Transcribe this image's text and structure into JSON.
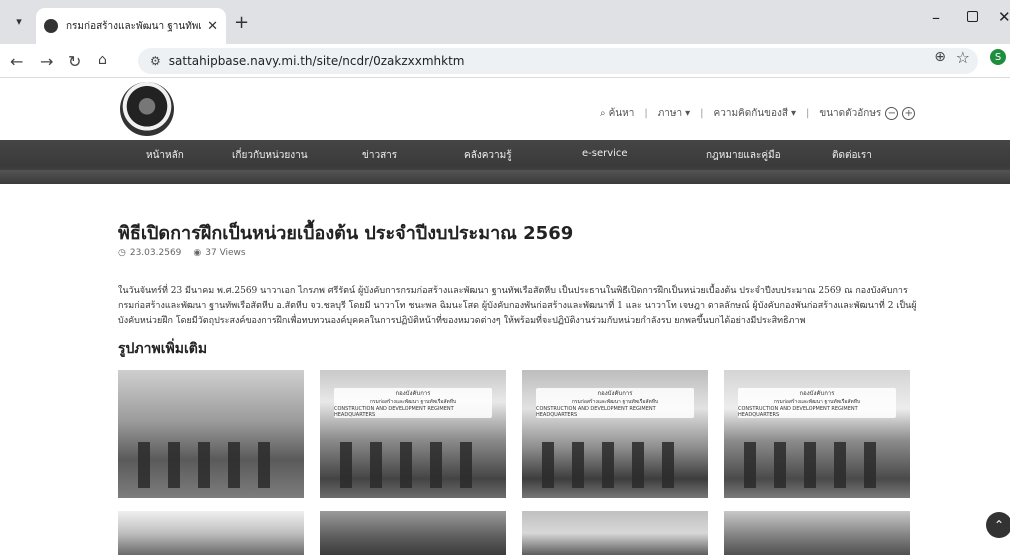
{
  "browser": {
    "tab_title": "กรมก่อสร้างและพัฒนา ฐานทัพเรือสัตหีบ",
    "tab_close": "✕",
    "new_tab": "+",
    "url": "sattahipbase.navy.mi.th/site/ncdr/0zakzxxmhktm",
    "profile_initial": "S"
  },
  "site": {
    "utilities": {
      "search": "ค้นหา",
      "language": "ภาษา",
      "contrast": "ความคิดกันของสี",
      "font_size": "ขนาดตัวอักษร",
      "font_minus": "−",
      "font_plus": "+"
    },
    "nav": [
      {
        "label": "หน้าหลัก"
      },
      {
        "label": "เกี่ยวกับหน่วยงาน"
      },
      {
        "label": "ข่าวสาร"
      },
      {
        "label": "คลังความรู้"
      },
      {
        "label": "e-service"
      },
      {
        "label": "กฎหมายและคู่มือ"
      },
      {
        "label": "ติดต่อเรา"
      }
    ]
  },
  "article": {
    "title": "พิธีเปิดการฝึกเป็นหน่วยเบื้องต้น ประจำปีงบประมาณ 2569",
    "date": "23.03.2569",
    "views": "37 Views",
    "body": "ในวันจันทร์ที่ 23 มีนาคม พ.ศ.2569 นาวาเอก ไกรภพ ศรีรัตน์ ผู้บังคับการกรมก่อสร้างและพัฒนา ฐานทัพเรือสัตหีบ เป็นประธานในพิธีเปิดการฝึกเป็นหน่วยเบื้องต้น ประจำปีงบประมาณ 2569 ณ กองบังคับการ กรมก่อสร้างและพัฒนา ฐานทัพเรือสัตหีบ อ.สัตหีบ จว.ชลบุรี โดยมี นาวาโท ชนะพล ฉิมนะโสด ผู้บังคับกองพันก่อสร้างและพัฒนาที่ 1 และ นาวาโท เจษฎา ดาลลักษณ์ ผู้บังคับกองพันก่อสร้างและพัฒนาที่ 2 เป็นผู้บังคับหน่วยฝึก โดยมีวัตถุประสงค์ของการฝึกเพื่อทบทวนองค์บุคคลในการปฏิบัติหน้าที่ของหมวดต่างๆ ให้พร้อมที่จะปฏิบัติงานร่วมกับหน่วยกำลังรบ ยกพลขึ้นบกได้อย่างมีประสิทธิภาพ",
    "gallery_title": "รูปภาพเพิ่มเติม",
    "sign_line1": "กองบังคับการ",
    "sign_line2": "กรมก่อสร้างและพัฒนา ฐานทัพเรือสัตหีบ",
    "sign_line3": "CONSTRUCTION AND DEVELOPMENT REGIMENT HEADQUARTERS"
  },
  "icons": {
    "tab_menu": "chevron-down-icon",
    "back": "back-arrow-icon",
    "forward": "forward-arrow-icon",
    "reload": "reload-icon",
    "home": "home-icon",
    "site_info": "site-info-icon",
    "zoom": "zoom-icon",
    "bookmark": "star-icon",
    "search": "search-icon",
    "clock": "clock-icon",
    "eye": "eye-icon",
    "scroll_top": "chevron-up-icon"
  },
  "colors": {
    "nav_bg": "#3a3a3a",
    "profile": "#1e8e3e"
  }
}
